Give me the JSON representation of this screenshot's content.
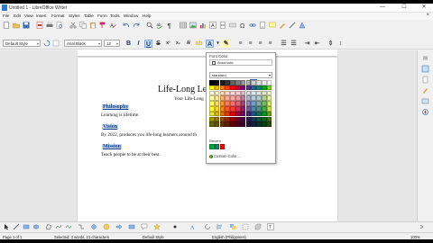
{
  "window": {
    "title": "Untitled 1 - LibreOffice Writer",
    "controls": [
      "—",
      "☐",
      "✕"
    ]
  },
  "menu": [
    "File",
    "Edit",
    "View",
    "Insert",
    "Format",
    "Styles",
    "Table",
    "Form",
    "Tools",
    "Window",
    "Help"
  ],
  "toolbar": {
    "paragraph_style": "Default Style",
    "font_name": "Arial Black",
    "font_size": "12"
  },
  "document": {
    "heading": "Life-Long Lea",
    "subheading": "Your Life-Long",
    "sections": [
      {
        "title": "Philosophy",
        "text": "Learning is lifetime."
      },
      {
        "title": "Vision",
        "text": "By 2022, produces you life-long learners around th"
      },
      {
        "title": "Mission",
        "text": "Teach people to be at their best."
      }
    ]
  },
  "color_popup": {
    "title": "Font Color",
    "automatic_label": "Automatic",
    "palette_name": "standard",
    "recent_label": "Recent",
    "custom_label": "Custom Color...",
    "highlight_index": 8,
    "palette": [
      "#000000",
      "#111111",
      "#1c1c1c",
      "#333333",
      "#666666",
      "#808080",
      "#999999",
      "#b2b2b2",
      "#cccccc",
      "#dddddd",
      "#eeeeee",
      "#ffffff",
      "#ffff00",
      "#ffbf00",
      "#ff8000",
      "#ff4000",
      "#ff0000",
      "#bf0041",
      "#800080",
      "#55308d",
      "#2a6099",
      "#158466",
      "#00a933",
      "#81d41a",
      "#ffffd7",
      "#fff5ce",
      "#ffdbb6",
      "#ffd8ce",
      "#ffd7d7",
      "#f7d1d5",
      "#e0c2cd",
      "#dedce6",
      "#dee6ef",
      "#dee7e5",
      "#dde8cb",
      "#f6f9d4",
      "#ffffa6",
      "#ffe994",
      "#ffb66c",
      "#ffaa95",
      "#ffa6a6",
      "#ec9ba4",
      "#bf819e",
      "#b7b3ca",
      "#b4c7dc",
      "#b3cac7",
      "#afd095",
      "#e8f2a1",
      "#ffff6d",
      "#ffde59",
      "#ff972f",
      "#ff7b59",
      "#ff6d6d",
      "#e16173",
      "#a1467e",
      "#8e86ae",
      "#729fcf",
      "#81aca6",
      "#77bc65",
      "#d4ea6b",
      "#ffff38",
      "#ffd428",
      "#ff860d",
      "#ff5429",
      "#ff3838",
      "#d62e4e",
      "#8d1d75",
      "#6b5e9b",
      "#5983b0",
      "#50938a",
      "#3faf46",
      "#c9e14f",
      "#e6e64c",
      "#e6b800",
      "#e67300",
      "#e63900",
      "#e60000",
      "#a10040",
      "#700070",
      "#44277a",
      "#255185",
      "#127258",
      "#009729",
      "#6da316",
      "#999900",
      "#997a00",
      "#994d00",
      "#992600",
      "#990000",
      "#6e002c",
      "#4d004d",
      "#2f1b54",
      "#1a365c",
      "#0c4d3c",
      "#006619",
      "#497010",
      "#666600",
      "#665200",
      "#663300",
      "#661a00",
      "#660000",
      "#4a001e",
      "#330033",
      "#1f1238",
      "#11243d",
      "#083328",
      "#004411",
      "#314a0b"
    ],
    "recent": [
      "#00a933",
      "#158466",
      "#ff0000"
    ]
  },
  "status": {
    "page": "Page 1 of 1",
    "selection": "Selected: 3 words, 21 characters",
    "style": "Default Style",
    "language": "English (Philippines)",
    "zoom": "100%"
  }
}
